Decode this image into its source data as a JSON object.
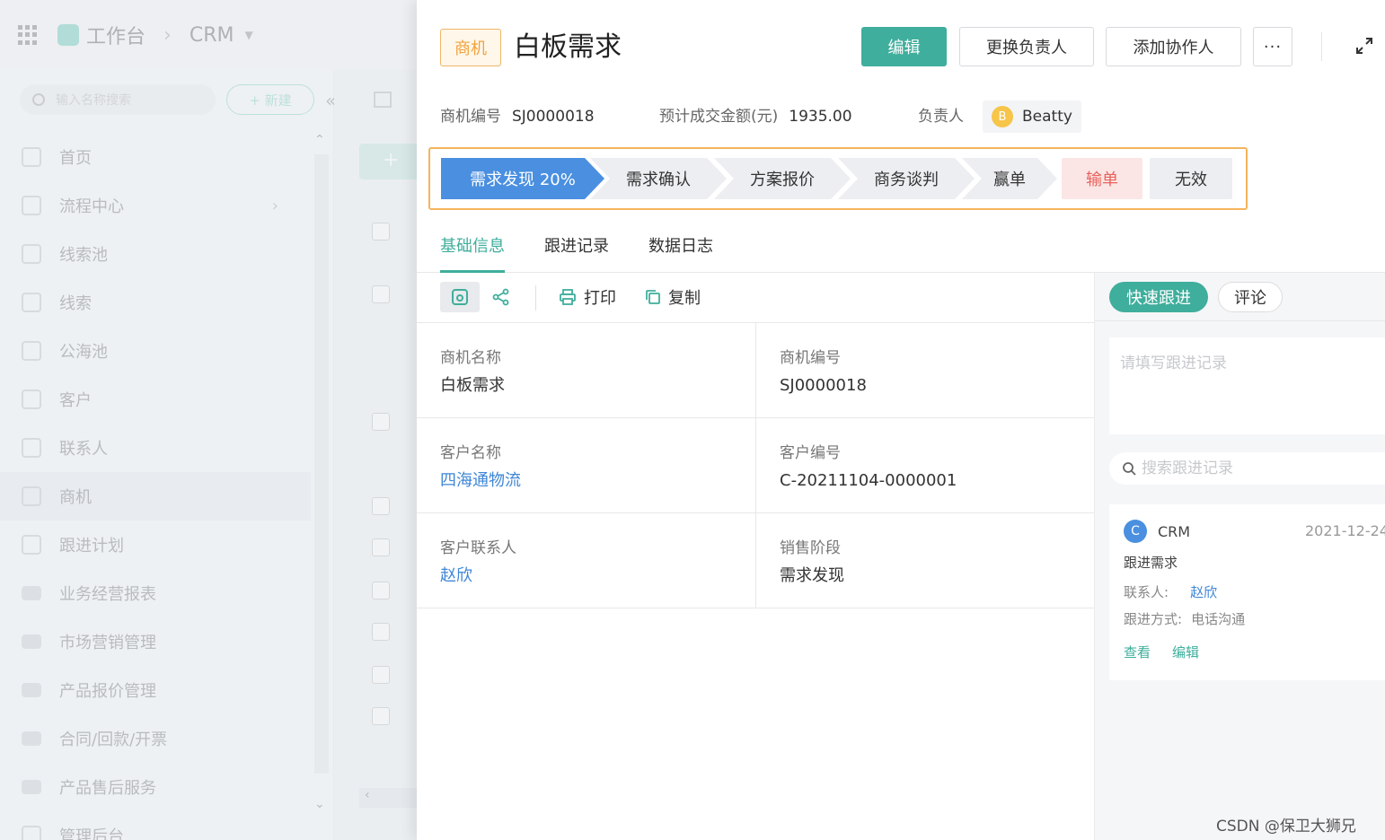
{
  "background": {
    "workspace_label": "工作台",
    "crumb": "CRM",
    "search_placeholder": "输入名称搜索",
    "new_button": "+ 新建",
    "nav": [
      {
        "label": "首页"
      },
      {
        "label": "流程中心"
      },
      {
        "label": "线索池"
      },
      {
        "label": "线索"
      },
      {
        "label": "公海池"
      },
      {
        "label": "客户"
      },
      {
        "label": "联系人"
      },
      {
        "label": "商机"
      },
      {
        "label": "跟进计划"
      },
      {
        "label": "业务经营报表"
      },
      {
        "label": "市场营销管理"
      },
      {
        "label": "产品报价管理"
      },
      {
        "label": "合同/回款/开票"
      },
      {
        "label": "产品售后服务"
      },
      {
        "label": "管理后台"
      }
    ]
  },
  "header": {
    "tag": "商机",
    "title": "白板需求",
    "edit_label": "编辑",
    "change_owner_label": "更换负责人",
    "add_collaborator_label": "添加协作人",
    "more_label": "···"
  },
  "meta": {
    "number_label": "商机编号",
    "number_value": "SJ0000018",
    "amount_label": "预计成交金额(元)",
    "amount_value": "1935.00",
    "owner_label": "负责人",
    "owner_initial": "B",
    "owner_name": "Beatty"
  },
  "stages": [
    "需求发现 20%",
    "需求确认",
    "方案报价",
    "商务谈判",
    "赢单",
    "输单",
    "无效"
  ],
  "tabs": [
    "基础信息",
    "跟进记录",
    "数据日志"
  ],
  "detail_toolbar": {
    "print": "打印",
    "copy": "复制"
  },
  "fields": [
    {
      "label": "商机名称",
      "value": "白板需求"
    },
    {
      "label": "商机编号",
      "value": "SJ0000018"
    },
    {
      "label": "客户名称",
      "value": "四海通物流"
    },
    {
      "label": "客户编号",
      "value": "C-20211104-0000001"
    },
    {
      "label": "客户联系人",
      "value": "赵欣"
    },
    {
      "label": "销售阶段",
      "value": "需求发现"
    }
  ],
  "followup": {
    "quick_label": "快速跟进",
    "comment_label": "评论",
    "textarea_placeholder": "请填写跟进记录",
    "search_placeholder": "搜索跟进记录",
    "card": {
      "avatar": "C",
      "source": "CRM",
      "date": "2021-12-24",
      "note": "跟进需求",
      "contact_label": "联系人:",
      "contact_value": "赵欣",
      "method_label": "跟进方式:",
      "method_value": "电话沟通",
      "view_label": "查看",
      "edit_label": "编辑"
    }
  },
  "watermark": "CSDN @保卫大狮兄",
  "colors": {
    "accent": "#3fae9c",
    "stage_active": "#4a8fe0",
    "tag": "#f0a23c",
    "lose": "#e8625c",
    "link": "#3e86d6"
  }
}
